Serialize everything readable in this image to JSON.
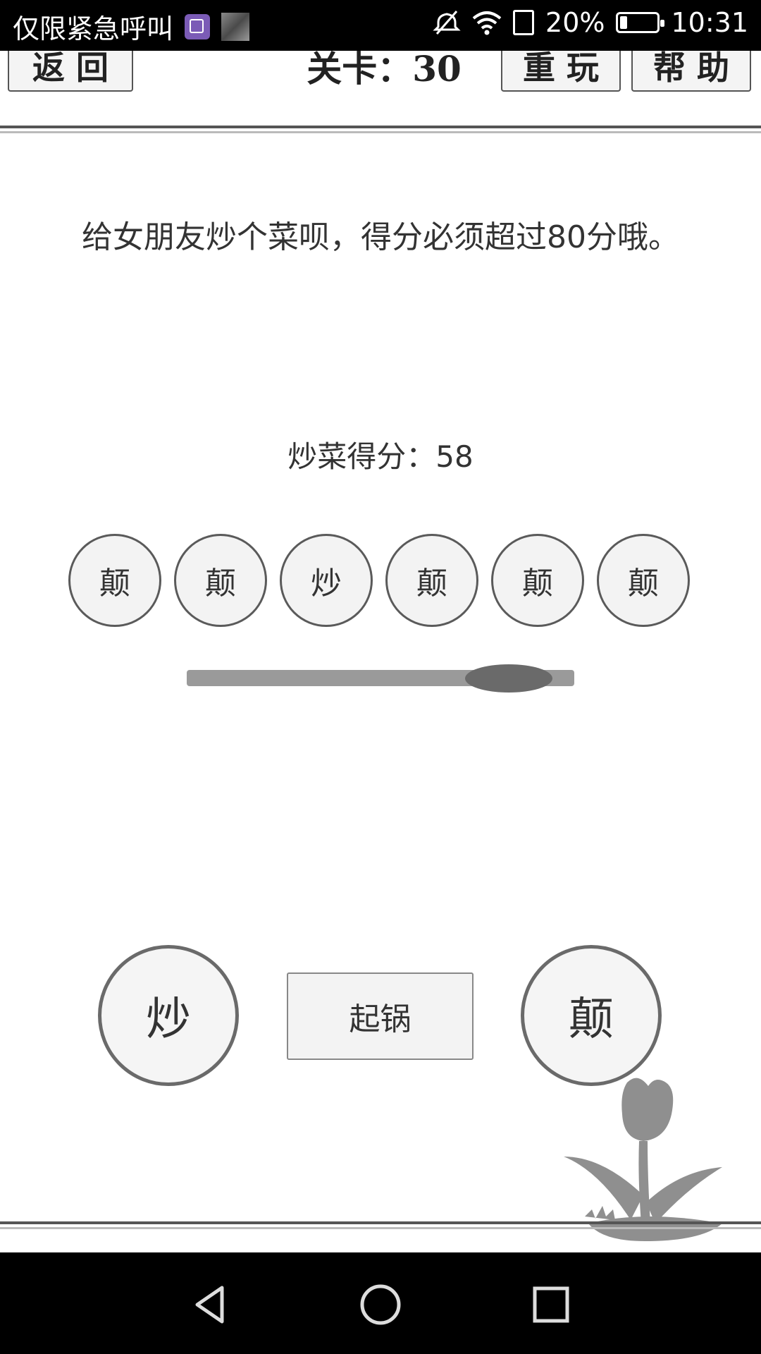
{
  "status_bar": {
    "carrier_text": "仅限紧急呼叫",
    "battery_percent": "20%",
    "battery_level": 0.2,
    "time": "10:31"
  },
  "header": {
    "back_label": "返 回",
    "level_label": "关卡：30",
    "replay_label": "重 玩",
    "help_label": "帮 助"
  },
  "game": {
    "prompt": "给女朋友炒个菜呗，得分必须超过80分哦。",
    "score_label": "炒菜得分：",
    "score_value": "58",
    "sequence": [
      "颠",
      "颠",
      "炒",
      "颠",
      "颠",
      "颠"
    ],
    "slider_value": 0.83,
    "stir_button": "炒",
    "serve_button": "起锅",
    "flip_button": "颠"
  },
  "colors": {
    "background": "#ffffff",
    "status_bar": "#000000",
    "circle_fill": "#f3f3f3",
    "circle_border": "#5a5a5a",
    "slider_track": "#9a9a9a",
    "slider_thumb": "#6a6a6a"
  }
}
